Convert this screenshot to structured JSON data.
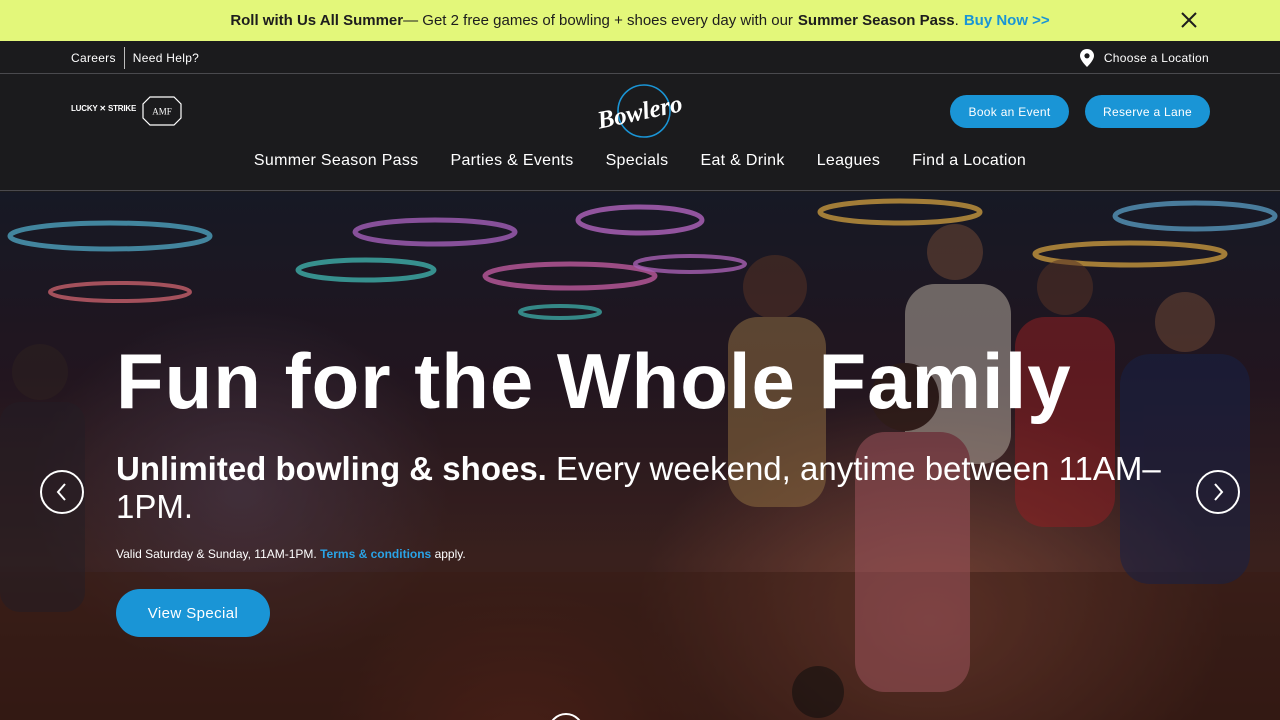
{
  "promo": {
    "lead": "Roll with Us All Summer",
    "middle": "— Get 2 free games of bowling + shoes every day with our",
    "pass": "Summer Season Pass",
    "period": ".",
    "cta": "Buy Now >>"
  },
  "utility": {
    "careers": "Careers",
    "help": "Need Help?",
    "location": "Choose a Location"
  },
  "brands": {
    "lucky": "LUCKY ✕ STRIKE",
    "amf": "AMF",
    "logo": "Bowlero"
  },
  "header": {
    "book": "Book an Event",
    "reserve": "Reserve a Lane"
  },
  "nav": [
    "Summer Season Pass",
    "Parties & Events",
    "Specials",
    "Eat & Drink",
    "Leagues",
    "Find a Location"
  ],
  "hero": {
    "title": "Fun for the Whole Family",
    "sub_bold": "Unlimited bowling & shoes.",
    "sub_rest": " Every weekend, anytime between 11AM–1PM.",
    "note_start": "Valid Saturday & Sunday, 11AM-1PM. ",
    "note_link": "Terms & conditions",
    "note_end": " apply.",
    "cta": "View Special"
  },
  "colors": {
    "promo_bg": "#e3f77a",
    "accent": "#1a95d6",
    "header_bg": "#1b1b1d"
  },
  "icons": {
    "close": "close-icon",
    "pin": "map-pin-icon",
    "prev": "chevron-left-icon",
    "next": "chevron-right-icon"
  }
}
